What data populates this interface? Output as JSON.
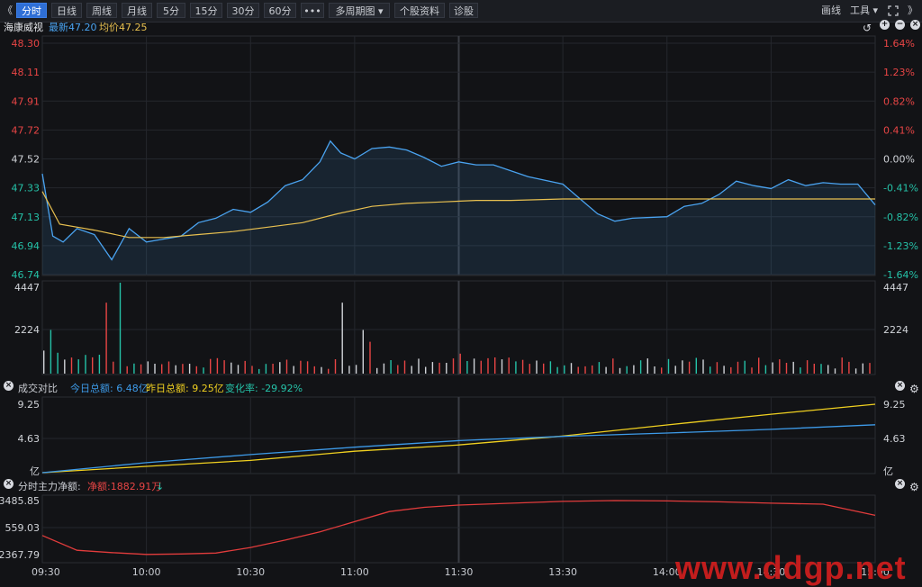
{
  "toolbar": {
    "back_glyph": "《",
    "tabs": [
      {
        "label": "分时",
        "active": true
      },
      {
        "label": "日线"
      },
      {
        "label": "周线"
      },
      {
        "label": "月线"
      },
      {
        "label": "5分"
      },
      {
        "label": "15分"
      },
      {
        "label": "30分"
      },
      {
        "label": "60分"
      },
      {
        "label": "•••"
      },
      {
        "label": "多周期图 ▾"
      },
      {
        "label": "个股资料"
      },
      {
        "label": "诊股"
      }
    ],
    "draw_label": "画线",
    "tools_label": "工具 ▾",
    "expand_icon": "fullscreen-icon",
    "forward_glyph": "》"
  },
  "price_panel": {
    "stock_name": "海康威视",
    "latest_label": "最新47.20",
    "avg_label": "均价47.25",
    "y_left": [
      "48.30",
      "48.11",
      "47.91",
      "47.72",
      "47.52",
      "47.33",
      "47.13",
      "46.94",
      "46.74"
    ],
    "y_right": [
      "1.64%",
      "1.23%",
      "0.82%",
      "0.41%",
      "0.00%",
      "-0.41%",
      "-0.82%",
      "-1.23%",
      "-1.64%"
    ],
    "vol_labels": [
      "4447",
      "2224"
    ]
  },
  "compare_panel": {
    "title": "成交对比",
    "today_label": "今日总额: 6.48亿",
    "yesterday_label": "昨日总额: 9.25亿",
    "change_label": "变化率: -29.92%",
    "y_labels": [
      "9.25",
      "4.63",
      "亿"
    ]
  },
  "flow_panel": {
    "title": "分时主力净额:",
    "net_label": "净额:1882.91万",
    "arrow": "↓",
    "y_labels": [
      "3485.85",
      "559.03",
      "-2367.79"
    ]
  },
  "x_labels": [
    "09:30",
    "10:00",
    "10:30",
    "11:00",
    "11:30",
    "13:30",
    "14:00",
    "14:30",
    "15:00"
  ],
  "watermark": "www.ddgp.net",
  "colors": {
    "price": "#4aa3f0",
    "avg": "#e8c050",
    "up": "#e84545",
    "down": "#25c2a8",
    "today": "#3d9ae8",
    "yesterday": "#f0d020",
    "flow": "#e23c3c"
  },
  "chart_data": [
    {
      "type": "line",
      "title": "海康威视",
      "xlabel": "",
      "ylabel": "",
      "ylim": [
        46.74,
        48.3
      ],
      "series": [
        {
          "name": "最新",
          "x": [
            "09:30",
            "09:33",
            "09:36",
            "09:40",
            "09:45",
            "09:50",
            "09:55",
            "10:00",
            "10:05",
            "10:10",
            "10:15",
            "10:20",
            "10:25",
            "10:30",
            "10:35",
            "10:40",
            "10:45",
            "10:50",
            "10:53",
            "10:56",
            "11:00",
            "11:05",
            "11:10",
            "11:15",
            "11:20",
            "11:25",
            "11:30",
            "13:05",
            "13:10",
            "13:20",
            "13:30",
            "13:40",
            "13:45",
            "13:50",
            "14:00",
            "14:05",
            "14:10",
            "14:15",
            "14:20",
            "14:25",
            "14:30",
            "14:35",
            "14:40",
            "14:45",
            "14:50",
            "14:55",
            "15:00"
          ],
          "values": [
            47.42,
            47.0,
            46.96,
            47.05,
            47.01,
            46.84,
            47.05,
            46.96,
            46.98,
            47.0,
            47.09,
            47.12,
            47.18,
            47.16,
            47.23,
            47.34,
            47.38,
            47.5,
            47.64,
            47.56,
            47.52,
            47.59,
            47.6,
            47.58,
            47.53,
            47.47,
            47.5,
            47.48,
            47.48,
            47.4,
            47.35,
            47.15,
            47.1,
            47.12,
            47.13,
            47.2,
            47.22,
            47.28,
            47.37,
            47.34,
            47.32,
            47.38,
            47.34,
            47.36,
            47.35,
            47.35,
            47.21
          ]
        },
        {
          "name": "均价",
          "x": [
            "09:30",
            "09:35",
            "09:45",
            "09:55",
            "10:05",
            "10:15",
            "10:25",
            "10:35",
            "10:45",
            "10:55",
            "11:05",
            "11:15",
            "11:25",
            "13:05",
            "13:15",
            "13:30",
            "14:00",
            "14:15",
            "14:30",
            "14:45",
            "15:00"
          ],
          "values": [
            47.3,
            47.08,
            47.04,
            46.99,
            46.99,
            47.01,
            47.03,
            47.06,
            47.09,
            47.15,
            47.2,
            47.22,
            47.23,
            47.24,
            47.24,
            47.25,
            47.25,
            47.25,
            47.25,
            47.25,
            47.25
          ]
        }
      ]
    },
    {
      "type": "line",
      "title": "成交对比",
      "xlabel": "",
      "ylabel": "亿",
      "ylim": [
        0,
        9.25
      ],
      "series": [
        {
          "name": "今日总额",
          "x": [
            "09:30",
            "10:00",
            "10:30",
            "11:00",
            "11:30",
            "13:30",
            "14:00",
            "14:30",
            "15:00"
          ],
          "values": [
            0.0,
            1.35,
            2.45,
            3.45,
            4.33,
            4.9,
            5.35,
            5.85,
            6.48
          ]
        },
        {
          "name": "昨日总额",
          "x": [
            "09:30",
            "10:00",
            "10:30",
            "11:00",
            "11:30",
            "13:30",
            "14:00",
            "14:30",
            "15:00"
          ],
          "values": [
            0.0,
            0.85,
            1.65,
            2.9,
            3.75,
            4.95,
            6.45,
            7.9,
            9.25
          ]
        }
      ]
    },
    {
      "type": "line",
      "title": "分时主力净额",
      "xlabel": "",
      "ylabel": "",
      "ylim": [
        -2367.79,
        3485.85
      ],
      "series": [
        {
          "name": "净额",
          "x": [
            "09:30",
            "09:40",
            "09:50",
            "10:00",
            "10:10",
            "10:20",
            "10:30",
            "10:40",
            "10:50",
            "11:00",
            "11:10",
            "11:20",
            "11:30",
            "13:30",
            "13:45",
            "14:00",
            "14:15",
            "14:30",
            "14:45",
            "15:00"
          ],
          "values": [
            -300,
            -1900,
            -2150,
            -2350,
            -2300,
            -2200,
            -1600,
            -800,
            100,
            1200,
            2300,
            2750,
            3000,
            3400,
            3485,
            3450,
            3350,
            3200,
            3100,
            1882.91
          ]
        }
      ]
    }
  ]
}
